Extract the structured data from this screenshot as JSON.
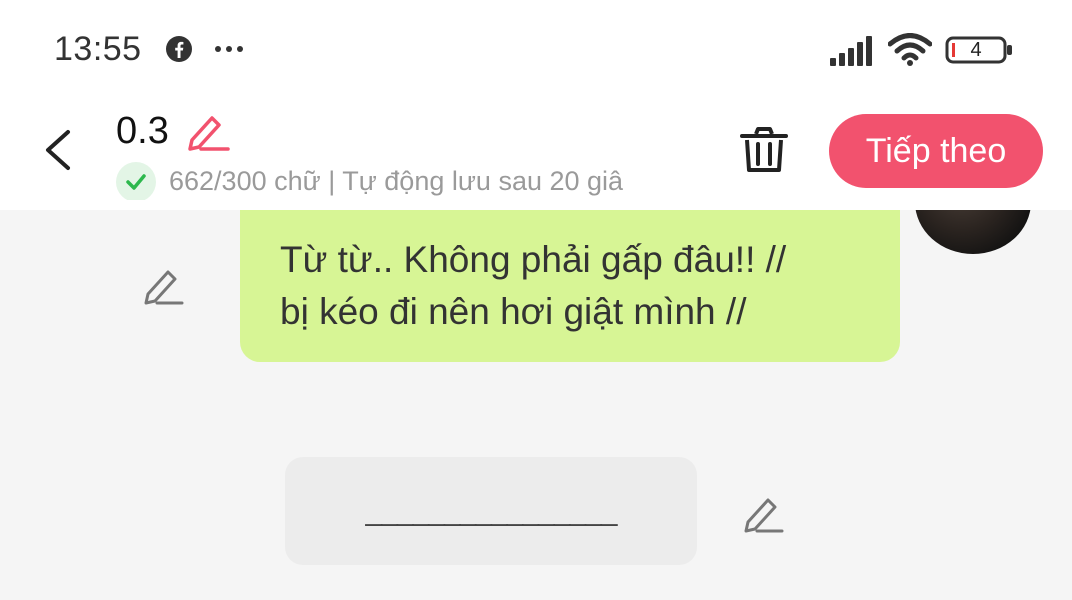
{
  "status_bar": {
    "time": "13:55",
    "battery_level": "4",
    "icons": [
      "facebook-icon",
      "more-dots-icon",
      "signal-icon",
      "wifi-icon",
      "battery-icon"
    ]
  },
  "header": {
    "title": "0.3",
    "status_text": "662/300 chữ | Tự động lưu sau 20 giâ",
    "next_label": "Tiếp theo",
    "icons": [
      "back-arrow-icon",
      "pencil-icon",
      "check-icon",
      "trash-icon"
    ]
  },
  "chat": {
    "message_lines": [
      "Từ từ.. Không phải gấp đâu!! //",
      "bị kéo đi nên hơi giật mình //"
    ],
    "blank_text": "________________"
  },
  "colors": {
    "accent": "#f2526e",
    "bubble": "#d7f595",
    "check": "#2db84d",
    "chat_bg": "#f5f5f5"
  }
}
